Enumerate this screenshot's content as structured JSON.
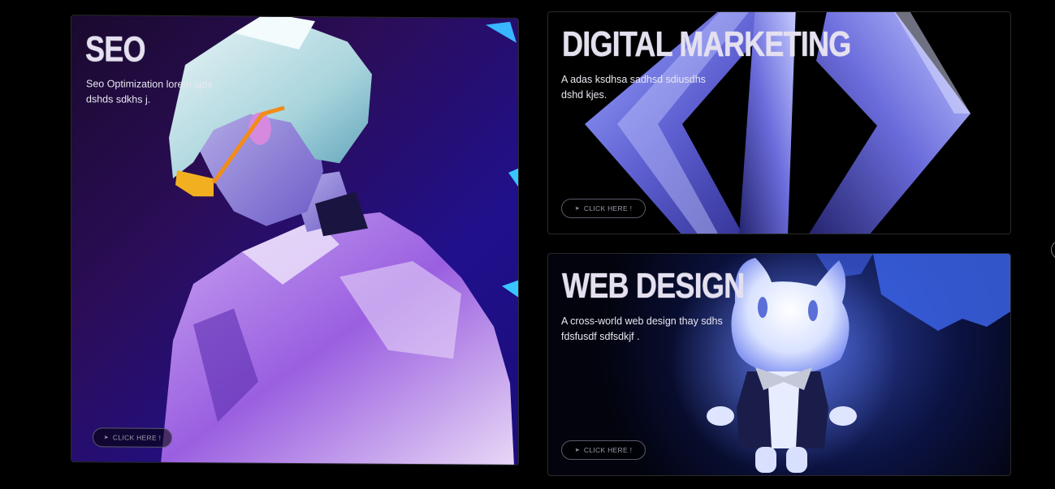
{
  "cards": [
    {
      "title": "SEO",
      "description": "Seo Optimization lorem sjds dshds sdkhs j.",
      "cta_label": "CLICK HERE !",
      "cta_icon": "cursor-arrow-icon"
    },
    {
      "title": "DIGITAL MARKETING",
      "description": "A adas ksdhsa sadhsd sdiusdhs dshd kjes.",
      "cta_label": "CLICK HERE !",
      "cta_icon": "cursor-arrow-icon"
    },
    {
      "title": "WEB DESIGN",
      "description": "A cross-world web design thay sdhs fdsfusdf sdfsdkjf .",
      "cta_label": "CLICK HERE !",
      "cta_icon": "cursor-arrow-icon"
    }
  ],
  "colors": {
    "background": "#000000",
    "title": "#e4e0ef",
    "seo_bg": "#2b0d58",
    "accent_blue": "#6b7bff",
    "accent_purple": "#9a6cff"
  }
}
